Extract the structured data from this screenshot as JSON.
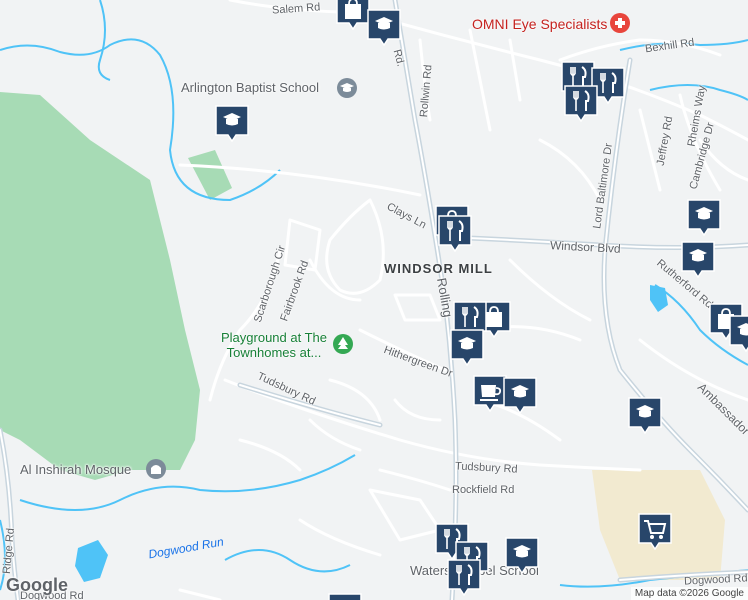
{
  "map": {
    "colors": {
      "background": "#f1f3f4",
      "park": "#a7dbb5",
      "water": "#4fc3f7",
      "road": "#ffffff",
      "arterial": "#c8d5de",
      "pin": "#28466a",
      "industrial": "#f2ead0"
    },
    "place": {
      "name": "WINDSOR MILL"
    },
    "streets": {
      "salem": "Salem Rd",
      "rolling_top": "Rd.",
      "rollwin": "Rollwin Rd",
      "bexhill": "Bexhill Rd",
      "rheims": "Rheims Way",
      "jeffrey": "Jeffrey Rd",
      "cambridge": "Cambridge Dr",
      "lord_baltimore": "Lord Baltimore Dr",
      "clays": "Clays Ln",
      "windsor": "Windsor Blvd",
      "rolling_main": "Rolling",
      "rutherford": "Rutherford Rd",
      "scarborough": "Scarborough Cir",
      "fairbrook": "Fairbrook Rd",
      "hithergreen": "Hithergreen Dr",
      "tudsbury_w": "Tudsbury Rd",
      "tudsbury_e": "Tudsbury Rd",
      "rockfield": "Rockfield Rd",
      "ambassador": "Ambassador",
      "ridge": "Ridge Rd",
      "dogwood_e": "Dogwood Rd",
      "dogwood_w": "Dogwood Rd"
    },
    "water_labels": {
      "dogwood_run": "Dogwood Run"
    },
    "pois": {
      "omni": "OMNI Eye Specialists",
      "arlington": "Arlington Baptist School",
      "playground": "Playground at The Townhomes at...",
      "mosque": "Al Inshirah Mosque",
      "chapel_partial": "Waters Chapel School"
    },
    "pins": [
      {
        "type": "shopping-bag",
        "icon": "shopping-bag-icon"
      },
      {
        "type": "school",
        "icon": "school-icon"
      },
      {
        "type": "school",
        "icon": "school-icon"
      },
      {
        "type": "restaurant",
        "icon": "restaurant-icon"
      },
      {
        "type": "restaurant",
        "icon": "restaurant-icon"
      },
      {
        "type": "restaurant",
        "icon": "restaurant-icon"
      },
      {
        "type": "shopping-bag",
        "icon": "shopping-bag-icon"
      },
      {
        "type": "restaurant",
        "icon": "restaurant-icon"
      },
      {
        "type": "school",
        "icon": "school-icon"
      },
      {
        "type": "school",
        "icon": "school-icon"
      },
      {
        "type": "shopping-bag",
        "icon": "shopping-bag-icon"
      },
      {
        "type": "school",
        "icon": "school-icon"
      },
      {
        "type": "shopping-bag",
        "icon": "shopping-bag-icon"
      },
      {
        "type": "restaurant",
        "icon": "restaurant-icon"
      },
      {
        "type": "school",
        "icon": "school-icon"
      },
      {
        "type": "cafe",
        "icon": "cafe-icon"
      },
      {
        "type": "school",
        "icon": "school-icon"
      },
      {
        "type": "school",
        "icon": "school-icon"
      },
      {
        "type": "shopping-cart",
        "icon": "shopping-cart-icon"
      },
      {
        "type": "restaurant",
        "icon": "restaurant-icon"
      },
      {
        "type": "restaurant",
        "icon": "restaurant-icon"
      },
      {
        "type": "school",
        "icon": "school-icon"
      },
      {
        "type": "restaurant",
        "icon": "restaurant-icon"
      },
      {
        "type": "school",
        "icon": "school-icon"
      }
    ],
    "branding": {
      "logo": "Google",
      "attribution": "Map data ©2026 Google"
    }
  }
}
